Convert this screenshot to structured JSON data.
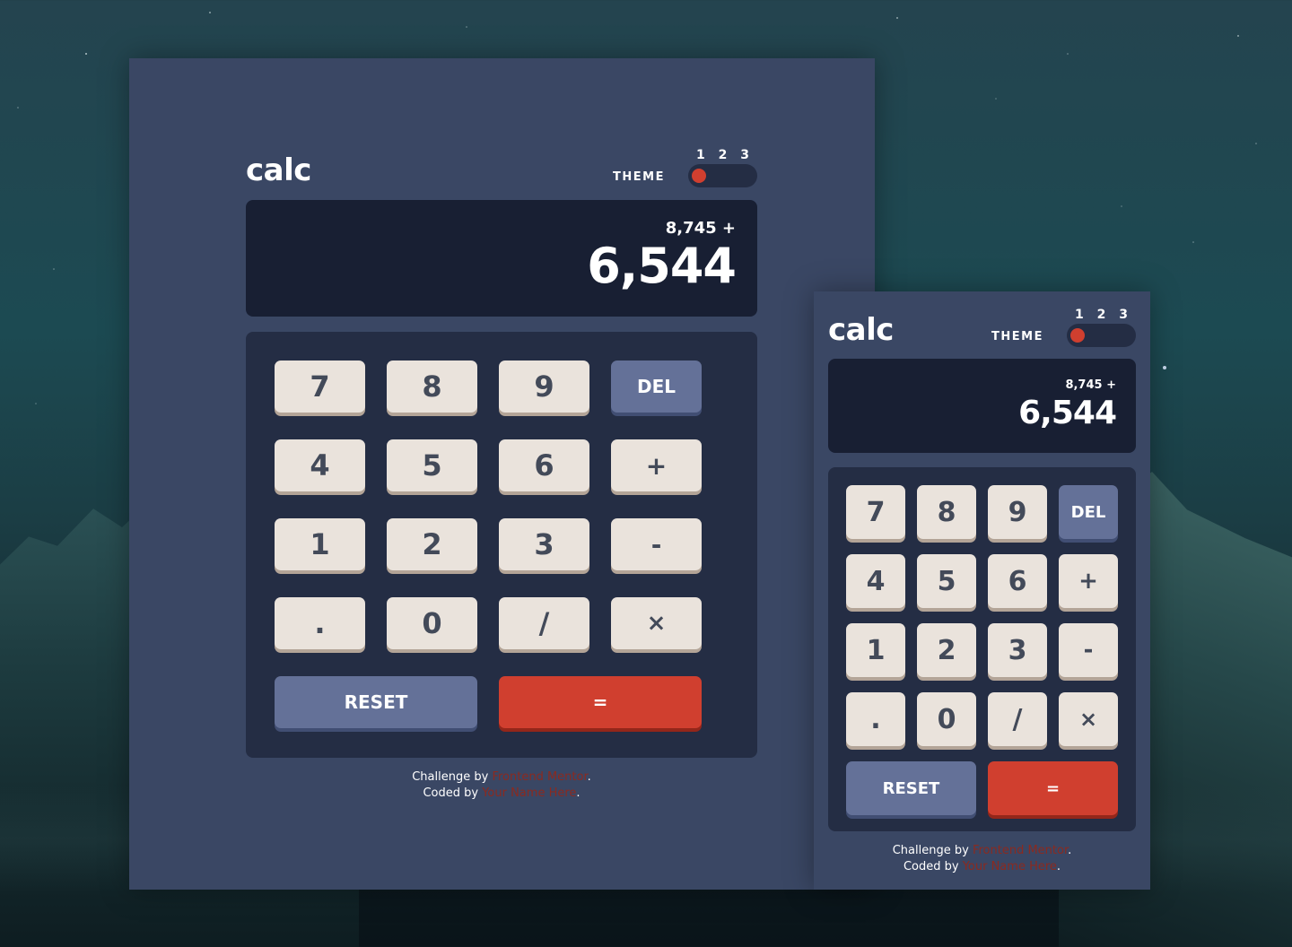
{
  "app": {
    "logo": "calc",
    "theme_label": "THEME",
    "theme_options": [
      "1",
      "2",
      "3"
    ],
    "selected_theme": "1"
  },
  "display": {
    "previous": "8,745 +",
    "current": "6,544"
  },
  "keys": {
    "seven": "7",
    "eight": "8",
    "nine": "9",
    "del": "DEL",
    "four": "4",
    "five": "5",
    "six": "6",
    "plus": "+",
    "one": "1",
    "two": "2",
    "three": "3",
    "minus": "-",
    "dot": ".",
    "zero": "0",
    "divide": "/",
    "times": "×",
    "reset": "RESET",
    "equals": "="
  },
  "footer": {
    "challenge_prefix": "Challenge by",
    "challenge_link": "Frontend Mentor",
    "coded_prefix": "Coded by",
    "coded_link": "Your Name Here",
    "period": "."
  },
  "colors": {
    "main_bg": "#3a4764",
    "toggle_keypad_bg": "#242d44",
    "screen_bg": "#181f33",
    "key_bg": "#eae3dc",
    "key_shadow": "#b3a497",
    "del_reset_bg": "#647198",
    "equals_bg": "#d03f2f",
    "text": "#434a59"
  }
}
